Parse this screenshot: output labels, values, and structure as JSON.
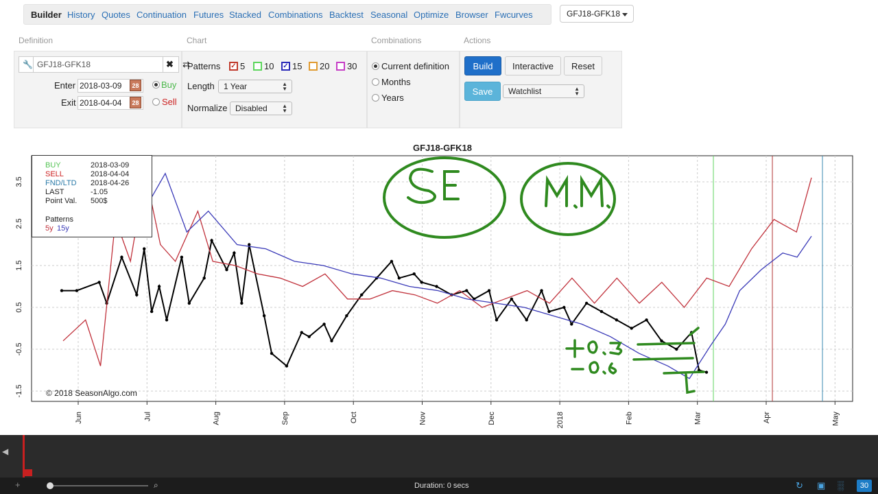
{
  "nav": {
    "items": [
      "Builder",
      "History",
      "Quotes",
      "Continuation",
      "Futures",
      "Stacked",
      "Combinations",
      "Backtest",
      "Seasonal",
      "Optimize",
      "Browser",
      "Fwcurves"
    ],
    "active": "Builder",
    "definition_selector": "GFJ18-GFK18"
  },
  "sections": {
    "definition": "Definition",
    "chart": "Chart",
    "combinations": "Combinations",
    "actions": "Actions"
  },
  "definition": {
    "symbol_value": "GFJ18-GFK18",
    "enter_label": "Enter",
    "enter_date": "2018-03-09",
    "exit_label": "Exit",
    "exit_date": "2018-04-04",
    "calendar_icon_text": "28",
    "buy_label": "Buy",
    "sell_label": "Sell",
    "selected_side": "Buy"
  },
  "chart_options": {
    "patterns_label": "Patterns",
    "patterns": [
      {
        "label": "5",
        "checked": true,
        "color": "#c0392b"
      },
      {
        "label": "10",
        "checked": false,
        "color": "#5cd65c"
      },
      {
        "label": "15",
        "checked": true,
        "color": "#2a2ab8"
      },
      {
        "label": "20",
        "checked": false,
        "color": "#e09a30"
      },
      {
        "label": "30",
        "checked": false,
        "color": "#c63ec6"
      }
    ],
    "length_label": "Length",
    "length_value": "1 Year",
    "normalize_label": "Normalize",
    "normalize_value": "Disabled"
  },
  "combinations": {
    "options": [
      "Current definition",
      "Months",
      "Years"
    ],
    "selected": "Current definition"
  },
  "actions": {
    "build": "Build",
    "interactive": "Interactive",
    "reset": "Reset",
    "save": "Save",
    "watchlist": "Watchlist"
  },
  "info_box": {
    "rows": [
      {
        "key": "BUY",
        "value": "2018-03-09",
        "color": "#55c455"
      },
      {
        "key": "SELL",
        "value": "2018-04-04",
        "color": "#cc2222"
      },
      {
        "key": "FND/LTD",
        "value": "2018-04-26",
        "color": "#2a7aa8"
      },
      {
        "key": "LAST",
        "value": "-1.05",
        "color": "#222222"
      },
      {
        "key": "Point Val.",
        "value": "500$",
        "color": "#222222"
      }
    ],
    "patterns_title": "Patterns",
    "pattern_5y": "5y",
    "pattern_15y": "15y"
  },
  "copyright": "© 2018 SeasonAlgo.com",
  "chart_data": {
    "type": "line",
    "title": "GFJ18-GFK18",
    "x_tick_labels": [
      "Jun",
      "Jul",
      "Aug",
      "Sep",
      "Oct",
      "Nov",
      "Dec",
      "2018",
      "Feb",
      "Mar",
      "Apr",
      "May"
    ],
    "y_tick_labels": [
      "3.5",
      "2.5",
      "1.5",
      "0.5",
      "-0.5",
      "-1.5"
    ],
    "ylim": [
      -1.5,
      3.5
    ],
    "grid": true,
    "vertical_markers": [
      {
        "label": "BUY",
        "date": "2018-03-09",
        "color": "#5cd65c"
      },
      {
        "label": "SELL",
        "date": "2018-04-04",
        "color": "#b03030"
      },
      {
        "label": "FND/LTD",
        "date": "2018-04-26",
        "color": "#3a8ab0"
      }
    ],
    "series": [
      {
        "name": "GFJ18-GFK18",
        "color": "#000000",
        "x": [
          0,
          0.02,
          0.05,
          0.06,
          0.08,
          0.1,
          0.11,
          0.12,
          0.13,
          0.14,
          0.16,
          0.17,
          0.19,
          0.2,
          0.22,
          0.23,
          0.24,
          0.25,
          0.27,
          0.28,
          0.3,
          0.32,
          0.33,
          0.35,
          0.36,
          0.38,
          0.4,
          0.42,
          0.44,
          0.45,
          0.47,
          0.48,
          0.5,
          0.52,
          0.54,
          0.55,
          0.57,
          0.58,
          0.6,
          0.62,
          0.64,
          0.65,
          0.67,
          0.68,
          0.7,
          0.72,
          0.74,
          0.76,
          0.78,
          0.8,
          0.82,
          0.84,
          0.85,
          0.86
        ],
        "values": [
          0.9,
          0.9,
          1.1,
          0.6,
          1.7,
          0.8,
          1.9,
          0.4,
          1.0,
          0.2,
          1.7,
          0.6,
          1.2,
          2.1,
          1.4,
          1.8,
          0.6,
          2.0,
          0.3,
          -0.6,
          -0.9,
          -0.1,
          -0.2,
          0.1,
          -0.3,
          0.3,
          0.8,
          1.2,
          1.6,
          1.2,
          1.3,
          1.1,
          1.0,
          0.8,
          0.9,
          0.7,
          0.9,
          0.2,
          0.7,
          0.2,
          0.9,
          0.4,
          0.5,
          0.1,
          0.6,
          0.4,
          0.2,
          0.0,
          0.2,
          -0.3,
          -0.5,
          -0.1,
          -1.0,
          -1.05
        ]
      },
      {
        "name": "5y",
        "color": "#c0303a",
        "x": [
          0,
          0.03,
          0.05,
          0.07,
          0.09,
          0.11,
          0.13,
          0.15,
          0.18,
          0.2,
          0.23,
          0.26,
          0.29,
          0.32,
          0.35,
          0.38,
          0.41,
          0.44,
          0.47,
          0.5,
          0.53,
          0.56,
          0.59,
          0.62,
          0.65,
          0.68,
          0.71,
          0.74,
          0.77,
          0.8,
          0.83,
          0.86,
          0.89,
          0.92,
          0.95,
          0.98,
          1.0
        ],
        "values": [
          -0.3,
          0.2,
          -0.9,
          2.6,
          1.6,
          3.7,
          2.0,
          1.6,
          2.8,
          1.6,
          1.5,
          1.3,
          1.2,
          1.0,
          1.3,
          0.7,
          0.7,
          0.9,
          0.8,
          0.6,
          0.9,
          0.5,
          0.7,
          0.9,
          0.6,
          1.2,
          0.6,
          1.2,
          0.6,
          1.1,
          0.5,
          1.2,
          1.0,
          1.9,
          2.6,
          2.3,
          3.6
        ]
      },
      {
        "name": "15y",
        "color": "#3a3ab8",
        "x": [
          0.08,
          0.1,
          0.13,
          0.16,
          0.2,
          0.24,
          0.28,
          0.32,
          0.36,
          0.4,
          0.44,
          0.48,
          0.52,
          0.56,
          0.6,
          0.64,
          0.68,
          0.72,
          0.76,
          0.8,
          0.83,
          0.86,
          0.88,
          0.9,
          0.93,
          0.96,
          0.98,
          1.0
        ],
        "values": [
          3.1,
          3.7,
          2.3,
          2.8,
          2.0,
          1.9,
          1.6,
          1.5,
          1.3,
          1.2,
          1.0,
          0.9,
          0.7,
          0.6,
          0.5,
          0.3,
          0.1,
          -0.2,
          -0.6,
          -0.9,
          -1.2,
          -0.4,
          0.1,
          0.9,
          1.4,
          1.8,
          1.7,
          2.2
        ]
      }
    ]
  }
}
